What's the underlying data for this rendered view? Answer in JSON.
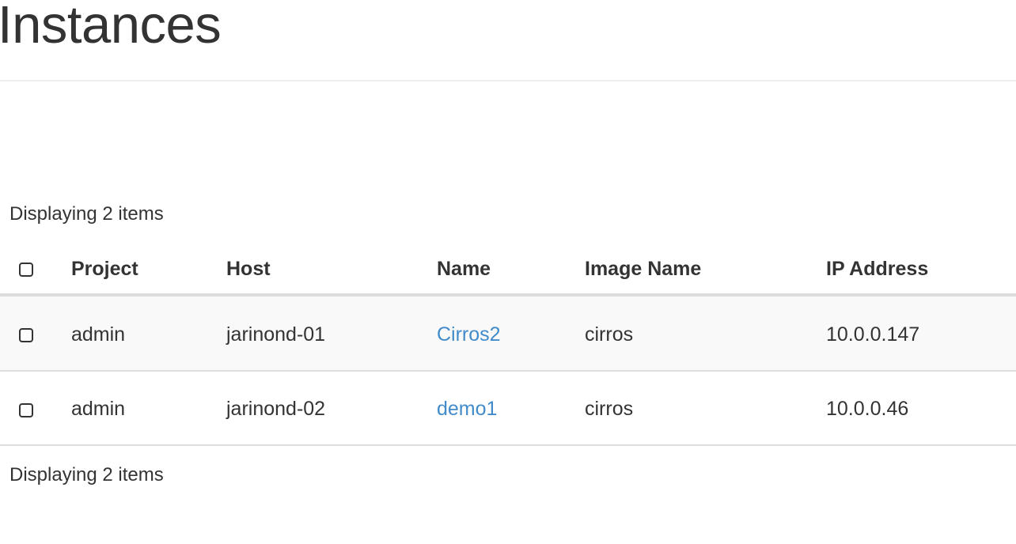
{
  "page": {
    "title": "Instances"
  },
  "table": {
    "count_top": "Displaying 2 items",
    "count_bottom": "Displaying 2 items",
    "columns": [
      "Project",
      "Host",
      "Name",
      "Image Name",
      "IP Address"
    ],
    "rows": [
      {
        "project": "admin",
        "host": "jarinond-01",
        "name": "Cirros2",
        "image": "cirros",
        "ip": "10.0.0.147"
      },
      {
        "project": "admin",
        "host": "jarinond-02",
        "name": "demo1",
        "image": "cirros",
        "ip": "10.0.0.46"
      }
    ]
  },
  "colors": {
    "text": "#333333",
    "link": "#428bca",
    "stripe": "#f9f9f9",
    "border": "#dddddd"
  }
}
